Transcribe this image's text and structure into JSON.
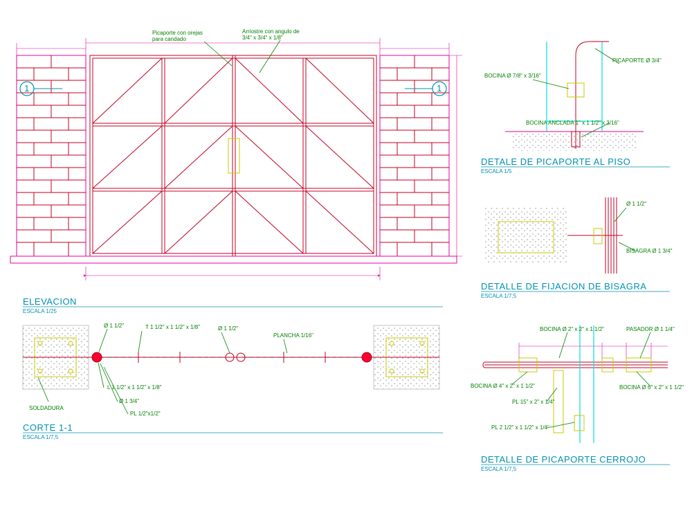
{
  "elevation": {
    "title": "ELEVACION",
    "scale": "ESCALA 1/25",
    "section_mark": "1",
    "anno_picaporte": "Picaporte con orejas\npara candado",
    "anno_arriostre": "Arriostre con angulo de\n3/4\" x 3/4\" x 1/8\""
  },
  "corte": {
    "title": "CORTE 1-1",
    "scale": "ESCALA 1/7,5",
    "soldadura": "SOLDADURA",
    "d1_12": "Ø 1 1/2\"",
    "t_angle": "T 1 1/2\" x 1 1/2\" x 1/8\"",
    "d1_12b": "Ø 1 1/2\"",
    "plancha": "PLANCHA 1/16\"",
    "l_angle": "L 1 1/2\" x 1 1/2\" x 1/8\"",
    "d1_34": "Ø 1 3/4\"",
    "pl_half": "PL 1/2\"x1/2\""
  },
  "picaporte_piso": {
    "title": "DETALE DE PICAPORTE AL PISO",
    "scale": "ESCALA 1/5",
    "bocina": "BOCINA Ø 7/8\" x 3/16\"",
    "picaporte": "PICAPORTE Ø 3/4\"",
    "bocina_anclada": "BOCINA ANCLADA 1\" x 1 1/2\" x 3/16\""
  },
  "bisagra": {
    "title": "DETALLE DE FIJACION DE BISAGRA",
    "scale": "ESCALA 1/7,5",
    "d1_12": "Ø 1 1/2\"",
    "bisagra_label": "BISAGRA Ø 1 3/4\""
  },
  "cerrojo": {
    "title": "DETALLE DE PICAPORTE CERROJO",
    "scale": "ESCALA 1/7,5",
    "bocina_2": "BOCINA Ø 2\" x 2\" x 1 1/2\"",
    "pasador": "PASADOR Ø 1 1/4\"",
    "bocina_4": "BOCINA Ø 4\" x 2\" x 1 1/2\"",
    "bocina_6": "BOCINA Ø 6\" x 2\" x 1 1/2\"",
    "pl_15": "PL 15\" x 2\" x 1/4\"",
    "pl_25": "PL 2 1/2\" x 1 1/2\" x 1/4\""
  }
}
